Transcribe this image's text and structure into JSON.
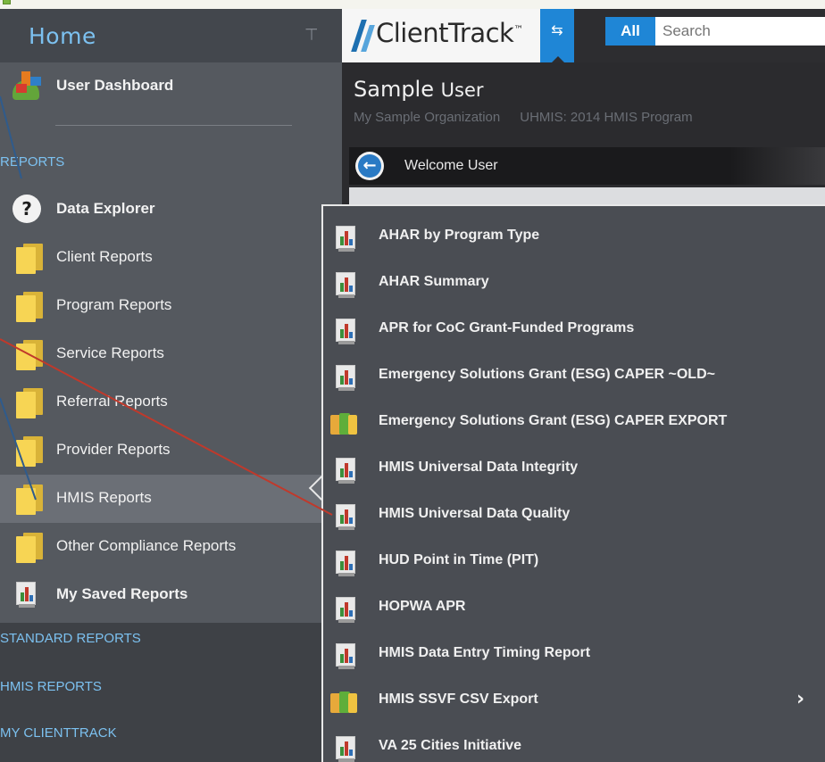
{
  "colors": {
    "accent_blue": "#1f86d6",
    "section_heading": "#7cc1f0",
    "sidebar_bg": "#55595f",
    "flyout_bg": "#4a4d53",
    "annotation_red": "#c0392b",
    "annotation_blue": "#2f5b8c"
  },
  "sidebar": {
    "home_title": "Home",
    "pin_icon": "pin-icon",
    "top_items": [
      {
        "label": "User Dashboard",
        "icon": "dashboard-icon"
      }
    ],
    "reports_heading": "REPORTS",
    "report_items": [
      {
        "label": "Data Explorer",
        "icon": "help-icon"
      },
      {
        "label": "Client Reports",
        "icon": "folder-icon"
      },
      {
        "label": "Program Reports",
        "icon": "folder-icon"
      },
      {
        "label": "Service Reports",
        "icon": "folder-icon"
      },
      {
        "label": "Referral Reports",
        "icon": "folder-icon"
      },
      {
        "label": "Provider Reports",
        "icon": "folder-icon"
      },
      {
        "label": "HMIS Reports",
        "icon": "folder-icon",
        "active": true
      },
      {
        "label": "Other Compliance Reports",
        "icon": "folder-icon"
      },
      {
        "label": "My Saved Reports",
        "icon": "report-icon"
      }
    ],
    "section_links": [
      "STANDARD REPORTS",
      "HMIS REPORTS",
      "MY CLIENTTRACK"
    ]
  },
  "topbar": {
    "logo_text": "ClientTrack",
    "logo_tm": "™",
    "swap_icon": "⇆",
    "scope_button": "All",
    "search_placeholder": "Search"
  },
  "header": {
    "user_first": "Sample",
    "user_second": "User",
    "organization": "My Sample Organization",
    "program": "UHMIS: 2014 HMIS Program",
    "welcome": "Welcome User",
    "back_icon": "arrow-left-icon"
  },
  "flyout": {
    "items": [
      {
        "label": "AHAR by Program Type",
        "icon": "report-icon"
      },
      {
        "label": "AHAR Summary",
        "icon": "report-icon"
      },
      {
        "label": "APR for CoC Grant-Funded Programs",
        "icon": "report-icon"
      },
      {
        "label": "Emergency Solutions Grant (ESG) CAPER ~OLD~",
        "icon": "report-icon"
      },
      {
        "label": "Emergency Solutions Grant (ESG) CAPER EXPORT",
        "icon": "export-icon"
      },
      {
        "label": "HMIS Universal Data Integrity",
        "icon": "report-icon"
      },
      {
        "label": "HMIS Universal Data Quality",
        "icon": "report-icon"
      },
      {
        "label": "HUD Point in Time (PIT)",
        "icon": "report-icon"
      },
      {
        "label": "HOPWA APR",
        "icon": "report-icon"
      },
      {
        "label": "HMIS Data Entry Timing Report",
        "icon": "report-icon"
      },
      {
        "label": "HMIS SSVF CSV Export",
        "icon": "export-icon",
        "submenu": true
      },
      {
        "label": "VA 25 Cities Initiative",
        "icon": "report-icon"
      }
    ],
    "submenu_chevron": "›"
  }
}
